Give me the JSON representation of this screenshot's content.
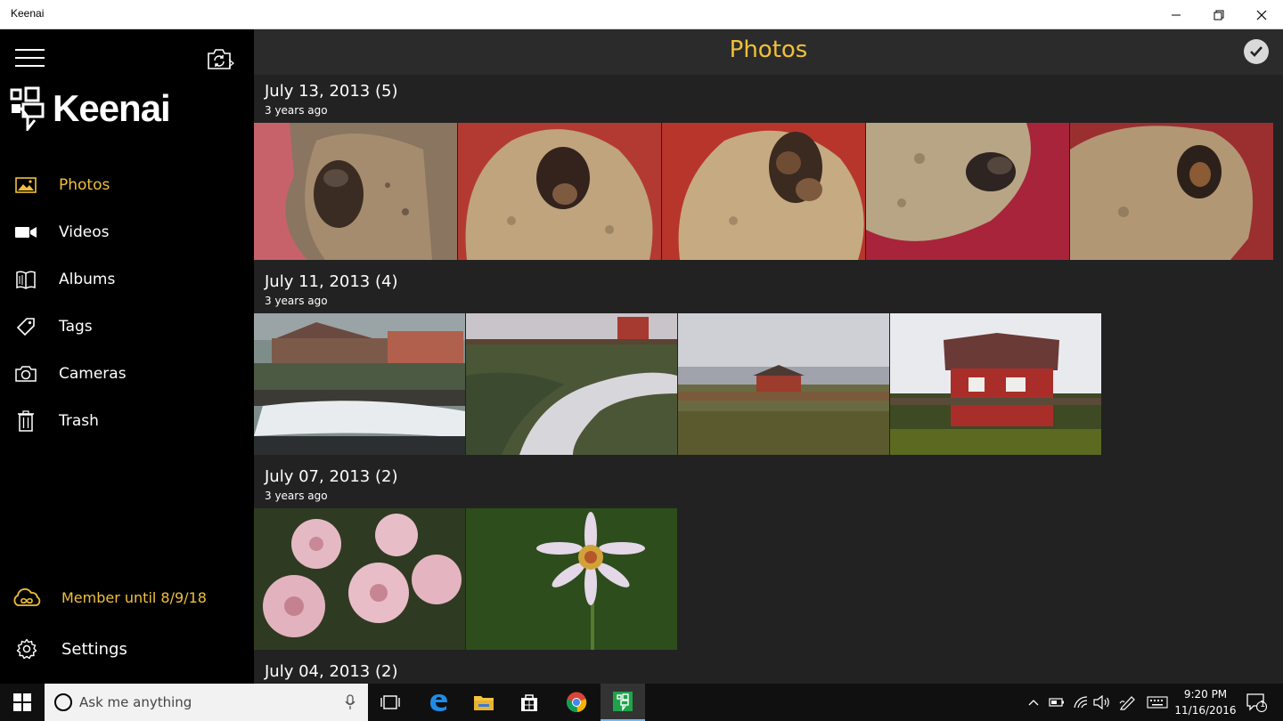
{
  "window": {
    "title": "Keenai"
  },
  "sidebar": {
    "logo_text": "Keenai",
    "items": [
      {
        "label": "Photos",
        "icon": "photo-icon",
        "active": true
      },
      {
        "label": "Videos",
        "icon": "video-camera-icon",
        "active": false
      },
      {
        "label": "Albums",
        "icon": "album-book-icon",
        "active": false
      },
      {
        "label": "Tags",
        "icon": "tag-icon",
        "active": false
      },
      {
        "label": "Cameras",
        "icon": "camera-icon",
        "active": false
      },
      {
        "label": "Trash",
        "icon": "trash-icon",
        "active": false
      }
    ],
    "member_label": "Member until 8/9/18",
    "settings_label": "Settings"
  },
  "header": {
    "title": "Photos"
  },
  "groups": [
    {
      "date": "July 13, 2013",
      "count": "(5)",
      "ago": "3 years ago"
    },
    {
      "date": "July 11, 2013",
      "count": "(4)",
      "ago": "3 years ago"
    },
    {
      "date": "July 07, 2013",
      "count": "(2)",
      "ago": "3 years ago"
    },
    {
      "date": "July 04, 2013",
      "count": "(2)",
      "ago": ""
    }
  ],
  "taskbar": {
    "search_placeholder": "Ask me anything",
    "time": "9:20 PM",
    "date": "11/16/2016",
    "notification_count": "1"
  },
  "colors": {
    "accent": "#f0c03b",
    "sidebar_bg": "#000000",
    "main_bg": "#222222",
    "header_bg": "#2b2b2b"
  }
}
